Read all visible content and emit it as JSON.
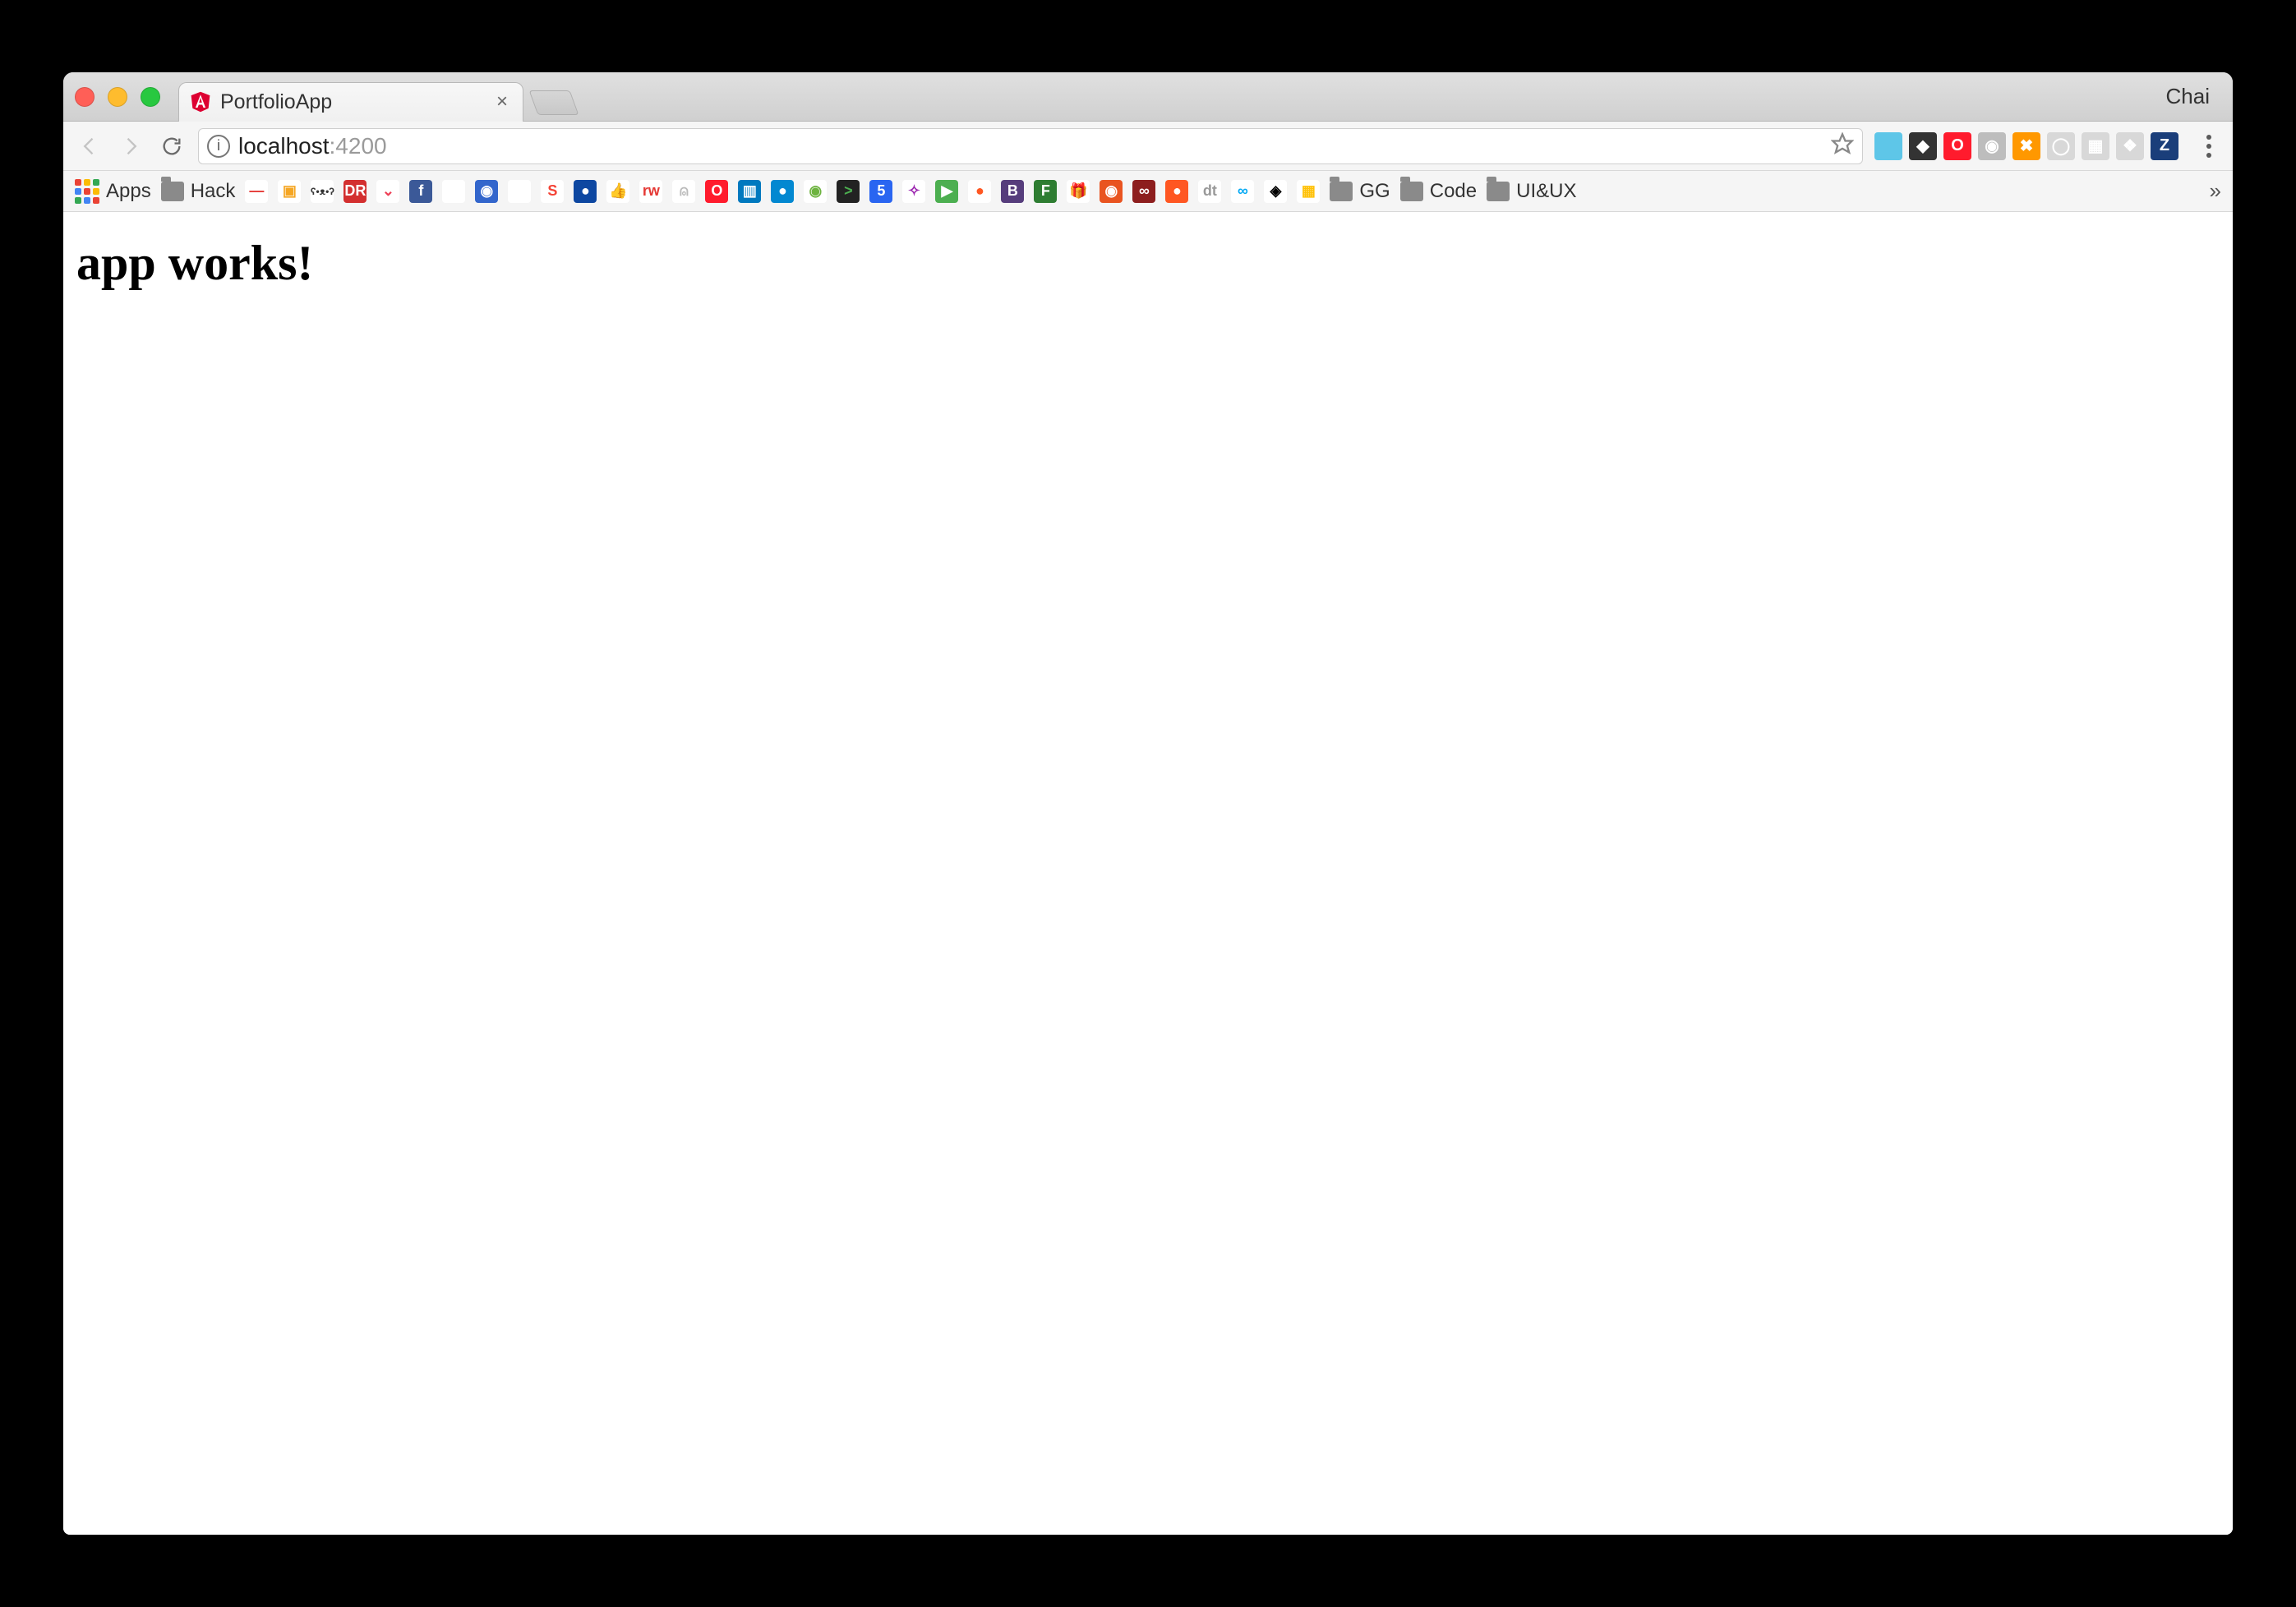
{
  "window": {
    "profile_label": "Chai"
  },
  "tab": {
    "title": "PortfolioApp",
    "favicon_name": "angular-icon",
    "favicon_color": "#dd0031"
  },
  "omnibox": {
    "host": "localhost",
    "port": ":4200"
  },
  "extensions": [
    {
      "name": "ext-evernote",
      "bg": "#5ec6e8",
      "glyph": ""
    },
    {
      "name": "ext-pocket-save",
      "bg": "#333",
      "glyph": "◆"
    },
    {
      "name": "ext-opera",
      "bg": "#ff1b2d",
      "glyph": "O"
    },
    {
      "name": "ext-camera",
      "bg": "#bdbdbd",
      "glyph": "◉"
    },
    {
      "name": "ext-orbit",
      "bg": "#ff9800",
      "glyph": "✖"
    },
    {
      "name": "ext-clock",
      "bg": "#d8d8d8",
      "glyph": "◯"
    },
    {
      "name": "ext-grid1",
      "bg": "#d8d8d8",
      "glyph": "▦"
    },
    {
      "name": "ext-grid2",
      "bg": "#d8d8d8",
      "glyph": "❖"
    },
    {
      "name": "ext-z",
      "bg": "#1a3e7a",
      "glyph": "Z"
    }
  ],
  "bookmarks_bar": {
    "apps_label": "Apps",
    "items": [
      {
        "type": "folder",
        "label": "Hack"
      },
      {
        "type": "icon",
        "name": "underscore-icon",
        "bg": "#ffffff",
        "fg": "#e53935",
        "glyph": "—"
      },
      {
        "type": "icon",
        "name": "box-icon",
        "bg": "#ffffff",
        "fg": "#f5a623",
        "glyph": "▣"
      },
      {
        "type": "icon",
        "name": "bear-icon",
        "bg": "#ffffff",
        "fg": "#333",
        "glyph": "ʕ•ᴥ•ʔ"
      },
      {
        "type": "icon",
        "name": "dr-icon",
        "bg": "#d32f2f",
        "fg": "#fff",
        "glyph": "DR"
      },
      {
        "type": "icon",
        "name": "pocket-icon",
        "bg": "#ffffff",
        "fg": "#ee4056",
        "glyph": "⌄"
      },
      {
        "type": "icon",
        "name": "facebook-icon",
        "bg": "#3b5998",
        "fg": "#fff",
        "glyph": "f"
      },
      {
        "type": "icon",
        "name": "github-icon",
        "bg": "#ffffff",
        "fg": "#000",
        "glyph": ""
      },
      {
        "type": "icon",
        "name": "shield-icon",
        "bg": "#3366cc",
        "fg": "#fff",
        "glyph": "◉"
      },
      {
        "type": "icon",
        "name": "reddit-icon",
        "bg": "#ffffff",
        "fg": "#ff4500",
        "glyph": ""
      },
      {
        "type": "icon",
        "name": "s-icon",
        "bg": "#ffffff",
        "fg": "#f44336",
        "glyph": "S"
      },
      {
        "type": "icon",
        "name": "droplet-icon",
        "bg": "#0d47a1",
        "fg": "#fff",
        "glyph": "●"
      },
      {
        "type": "icon",
        "name": "thumb-icon",
        "bg": "#ffffff",
        "fg": "#ff9800",
        "glyph": "👍"
      },
      {
        "type": "icon",
        "name": "rw-icon",
        "bg": "#ffffff",
        "fg": "#e53935",
        "glyph": "rw"
      },
      {
        "type": "icon",
        "name": "ghost-icon",
        "bg": "#ffffff",
        "fg": "#bbb",
        "glyph": "⍝"
      },
      {
        "type": "icon",
        "name": "opera-bm-icon",
        "bg": "#ff1b2d",
        "fg": "#fff",
        "glyph": "O"
      },
      {
        "type": "icon",
        "name": "trello-icon",
        "bg": "#0079bf",
        "fg": "#fff",
        "glyph": "▥"
      },
      {
        "type": "icon",
        "name": "key-icon",
        "bg": "#0288d1",
        "fg": "#fff",
        "glyph": "●"
      },
      {
        "type": "icon",
        "name": "spring-icon",
        "bg": "#ffffff",
        "fg": "#6db33f",
        "glyph": "◉"
      },
      {
        "type": "icon",
        "name": "terminal-icon",
        "bg": "#222",
        "fg": "#4caf50",
        "glyph": ">"
      },
      {
        "type": "icon",
        "name": "html5-icon",
        "bg": "#2965f1",
        "fg": "#fff",
        "glyph": "5"
      },
      {
        "type": "icon",
        "name": "uikit-icon",
        "bg": "#ffffff",
        "fg": "#9c27b0",
        "glyph": "✧"
      },
      {
        "type": "icon",
        "name": "play-icon",
        "bg": "#4caf50",
        "fg": "#fff",
        "glyph": "▶"
      },
      {
        "type": "icon",
        "name": "orange-dot-icon",
        "bg": "#ffffff",
        "fg": "#ff5722",
        "glyph": "●"
      },
      {
        "type": "icon",
        "name": "bootstrap-icon",
        "bg": "#563d7c",
        "fg": "#fff",
        "glyph": "B"
      },
      {
        "type": "icon",
        "name": "f-icon",
        "bg": "#2e7d32",
        "fg": "#fff",
        "glyph": "F"
      },
      {
        "type": "icon",
        "name": "gift-icon",
        "bg": "#ffffff",
        "fg": "#d32f2f",
        "glyph": "🎁"
      },
      {
        "type": "icon",
        "name": "ubuntu-icon",
        "bg": "#e95420",
        "fg": "#fff",
        "glyph": "◉"
      },
      {
        "type": "icon",
        "name": "eyes-icon",
        "bg": "#8d1e1e",
        "fg": "#fff",
        "glyph": "∞"
      },
      {
        "type": "icon",
        "name": "red-dot-icon",
        "bg": "#ff5722",
        "fg": "#fff",
        "glyph": "●"
      },
      {
        "type": "icon",
        "name": "dt-icon",
        "bg": "#ffffff",
        "fg": "#999",
        "glyph": "dt"
      },
      {
        "type": "icon",
        "name": "cloud-icon",
        "bg": "#ffffff",
        "fg": "#03a9f4",
        "glyph": "∞"
      },
      {
        "type": "icon",
        "name": "codepen-icon",
        "bg": "#ffffff",
        "fg": "#000",
        "glyph": "◈"
      },
      {
        "type": "icon",
        "name": "grid-icon",
        "bg": "#ffffff",
        "fg": "#ffc107",
        "glyph": "▦"
      },
      {
        "type": "folder",
        "label": "GG"
      },
      {
        "type": "folder",
        "label": "Code"
      },
      {
        "type": "folder",
        "label": "UI&UX"
      }
    ],
    "overflow_glyph": "»"
  },
  "page": {
    "heading": "app works!"
  }
}
